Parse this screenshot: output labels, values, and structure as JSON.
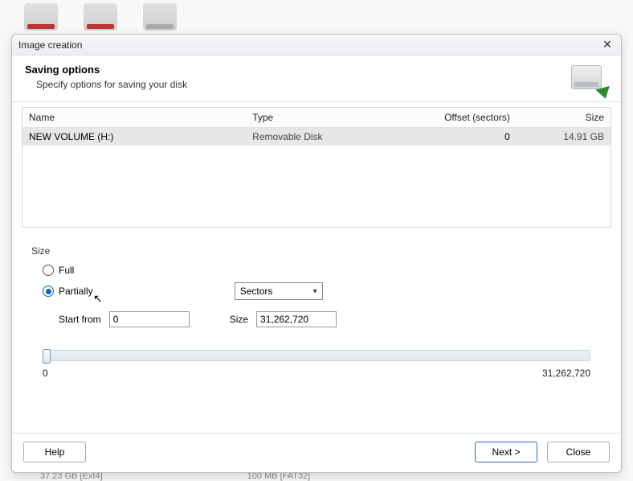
{
  "background": {
    "footer_left": "37.23 GB [Ext4]",
    "footer_right": "100 MB [FAT32]"
  },
  "dialog": {
    "title": "Image creation",
    "header_title": "Saving options",
    "header_sub": "Specify options for saving your disk"
  },
  "table": {
    "columns": {
      "name": "Name",
      "type": "Type",
      "offset": "Offset (sectors)",
      "size": "Size"
    },
    "rows": [
      {
        "name": "NEW VOLUME (H:)",
        "type": "Removable Disk",
        "offset": "0",
        "size": "14.91 GB"
      }
    ]
  },
  "size_group": {
    "legend": "Size",
    "full_label": "Full",
    "partial_label": "Partially",
    "unit_selected": "Sectors",
    "start_label": "Start from",
    "start_value": "0",
    "size_label": "Size",
    "size_value": "31,262,720",
    "slider_min": "0",
    "slider_max": "31,262,720"
  },
  "buttons": {
    "help": "Help",
    "next": "Next >",
    "close": "Close"
  }
}
